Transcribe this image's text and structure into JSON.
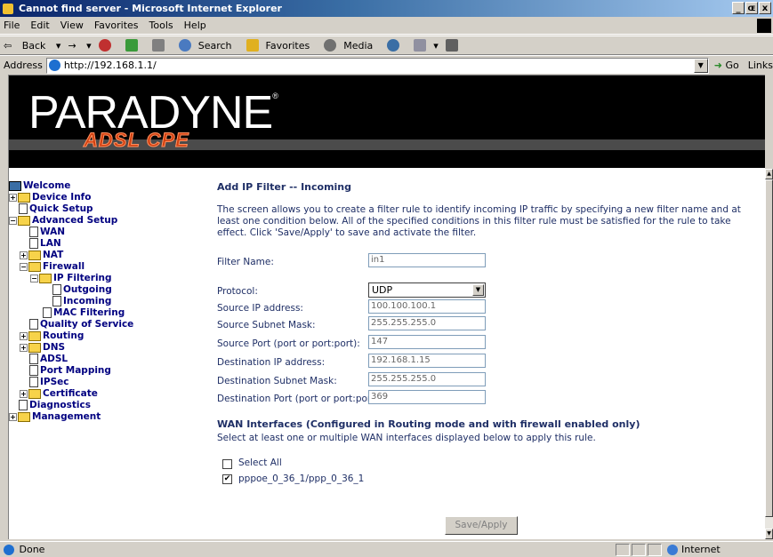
{
  "window": {
    "title": "Cannot find server - Microsoft Internet Explorer",
    "buttons": [
      "_",
      "ɶ",
      "x"
    ]
  },
  "menu": [
    "File",
    "Edit",
    "View",
    "Favorites",
    "Tools",
    "Help"
  ],
  "toolbar": {
    "back": "Back",
    "forward": "→",
    "search": "Search",
    "favorites": "Favorites",
    "media": "Media"
  },
  "address": {
    "label": "Address",
    "url": "http://192.168.1.1/",
    "go": "Go",
    "links": "Links"
  },
  "banner": {
    "brand": "PARADYNE",
    "reg": "®",
    "product": "ADSL CPE"
  },
  "tree": {
    "welcome": "Welcome",
    "device_info": "Device Info",
    "quick_setup": "Quick Setup",
    "advanced_setup": "Advanced Setup",
    "wan": "WAN",
    "lan": "LAN",
    "nat": "NAT",
    "firewall": "Firewall",
    "ip_filtering": "IP Filtering",
    "outgoing": "Outgoing",
    "incoming": "Incoming",
    "mac_filtering": "MAC Filtering",
    "qos": "Quality of Service",
    "routing": "Routing",
    "dns": "DNS",
    "adsl": "ADSL",
    "port_mapping": "Port Mapping",
    "ipsec": "IPSec",
    "certificate": "Certificate",
    "diagnostics": "Diagnostics",
    "management": "Management"
  },
  "page": {
    "heading": "Add IP Filter -- Incoming",
    "description": "The screen allows you to create a filter rule to identify incoming IP traffic by specifying a new filter name and at least one condition below. All of the specified conditions in this filter rule must be satisfied for the rule to take effect. Click 'Save/Apply' to save and activate the filter."
  },
  "form": {
    "filter_name": {
      "label": "Filter Name:",
      "value": "in1"
    },
    "protocol": {
      "label": "Protocol:",
      "value": "UDP"
    },
    "src_ip": {
      "label": "Source IP address:",
      "value": "100.100.100.1"
    },
    "src_mask": {
      "label": "Source Subnet Mask:",
      "value": "255.255.255.0"
    },
    "src_port": {
      "label": "Source Port (port or port:port):",
      "value": "147"
    },
    "dst_ip": {
      "label": "Destination IP address:",
      "value": "192.168.1.15"
    },
    "dst_mask": {
      "label": "Destination Subnet Mask:",
      "value": "255.255.255.0"
    },
    "dst_port": {
      "label": "Destination Port (port or port:port):",
      "value": "369"
    }
  },
  "wan": {
    "heading": "WAN Interfaces (Configured in Routing mode and with firewall enabled only)",
    "desc": "Select at least one or multiple WAN interfaces displayed below to apply this rule.",
    "select_all": {
      "label": "Select All",
      "checked": false
    },
    "iface": {
      "label": "pppoe_0_36_1/ppp_0_36_1",
      "checked": true
    }
  },
  "save_button": "Save/Apply",
  "status": {
    "text": "Done",
    "zone": "Internet"
  }
}
